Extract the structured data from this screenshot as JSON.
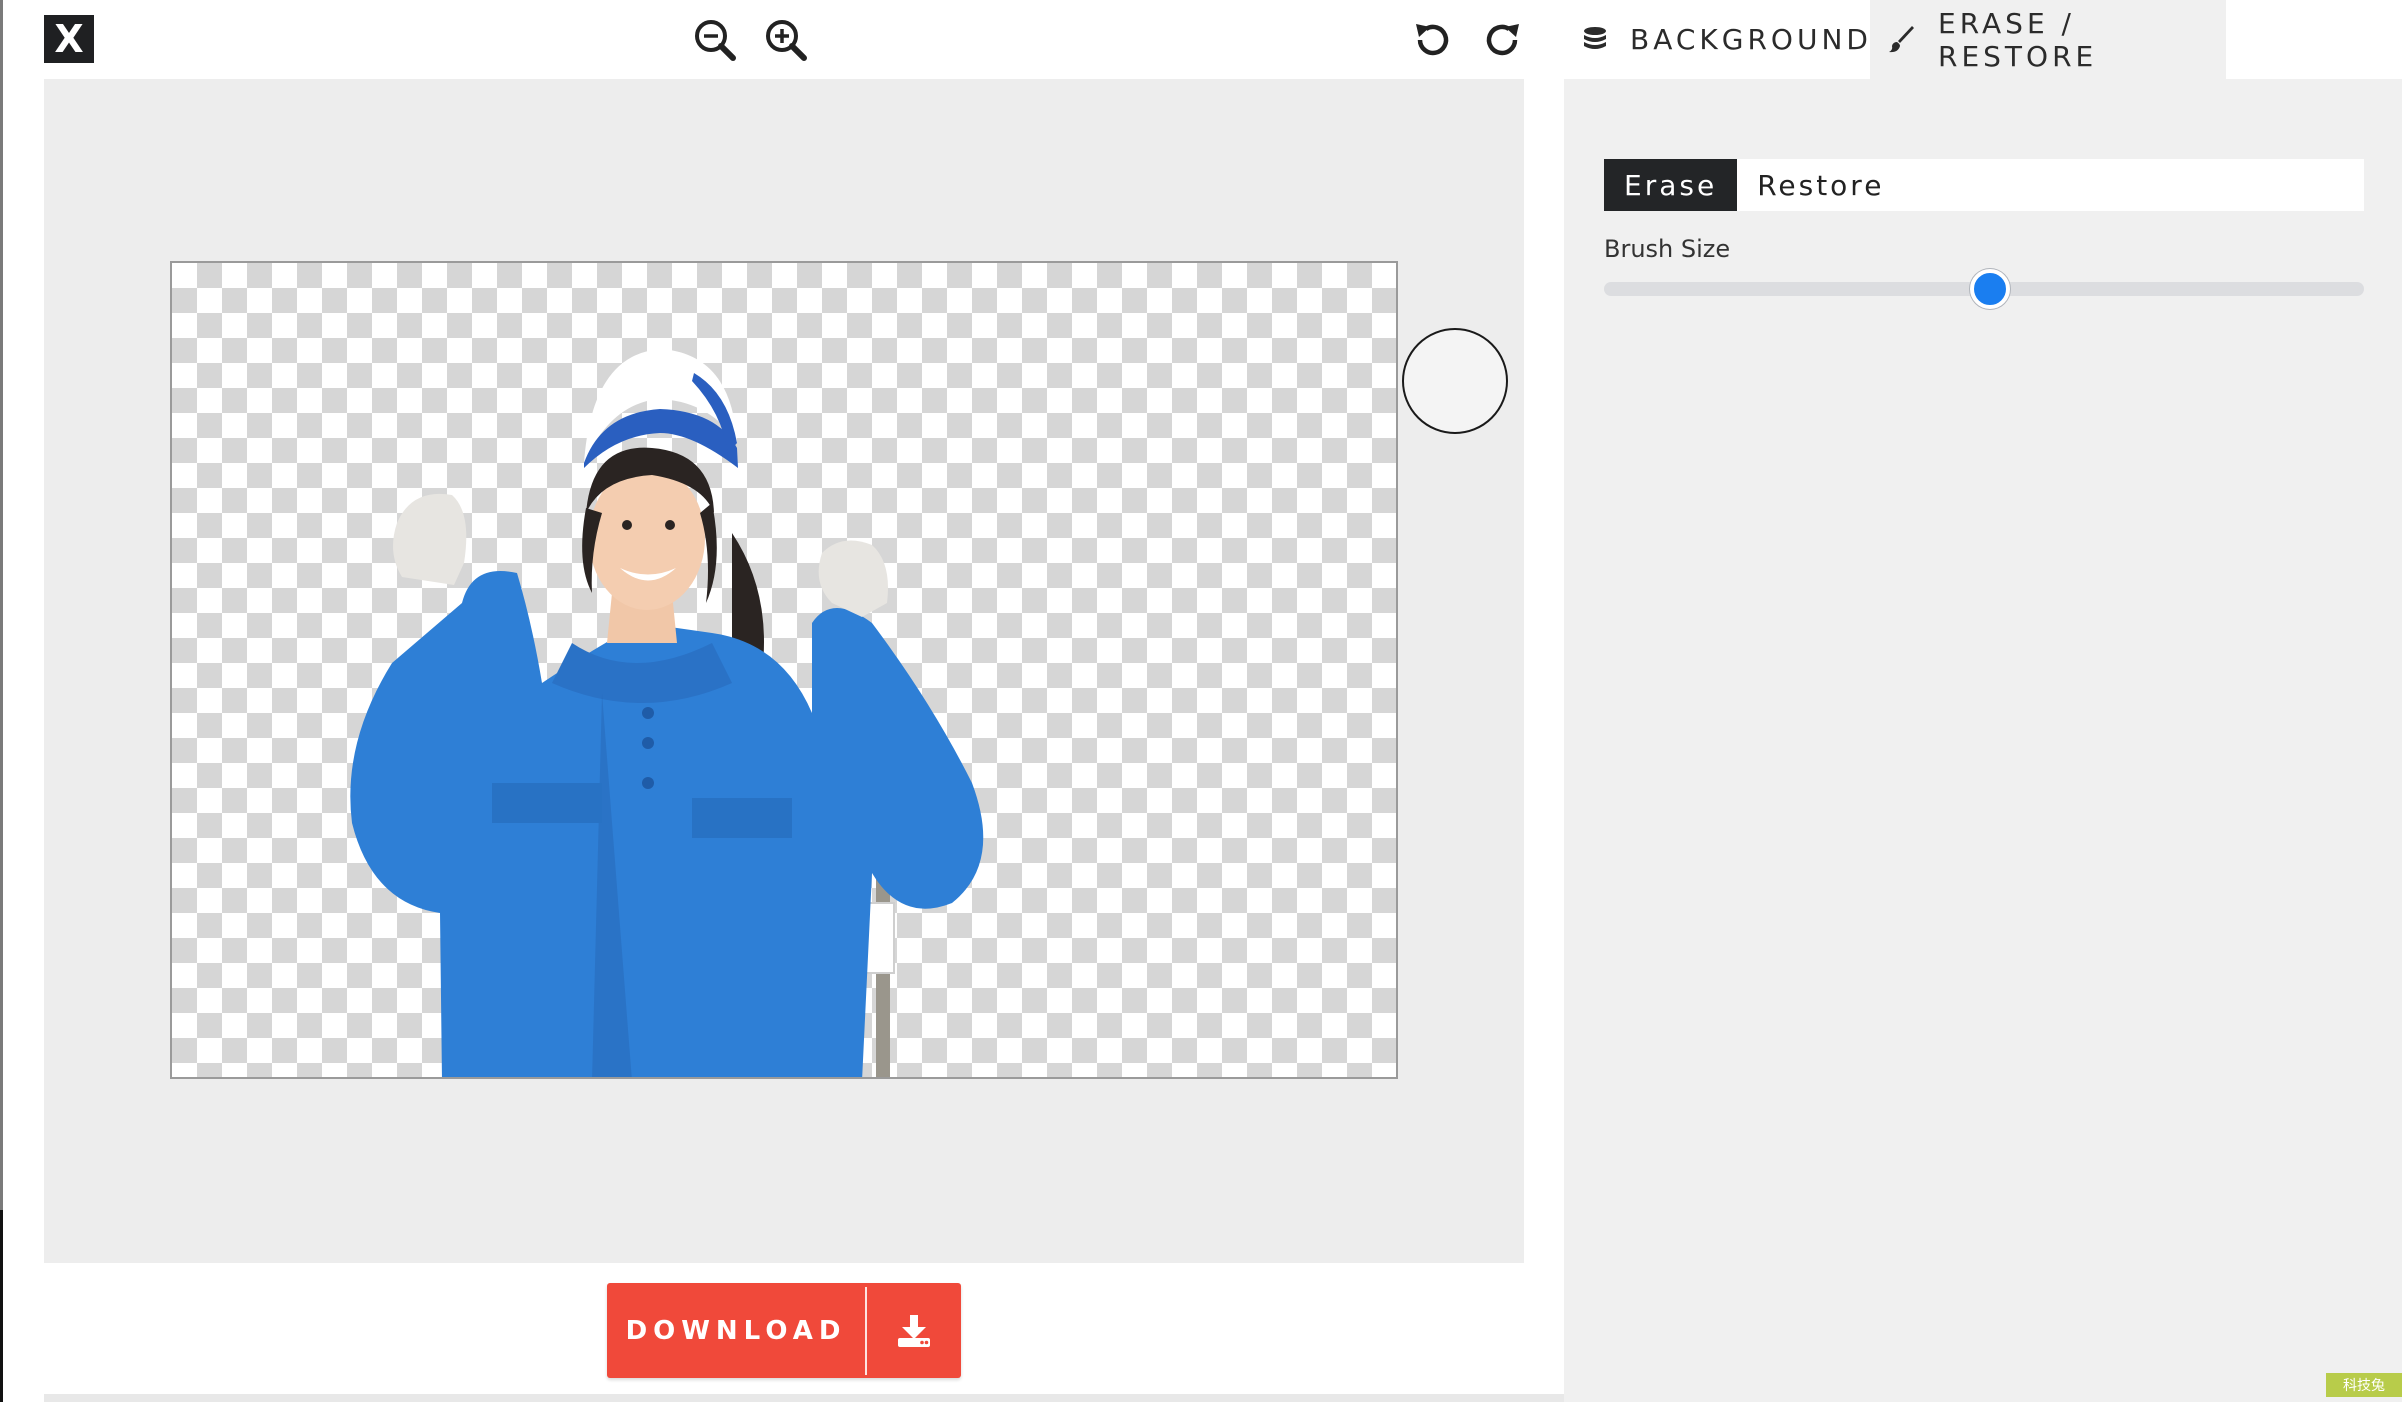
{
  "toolbar": {
    "close_label": "X",
    "icons": [
      "zoom-out-icon",
      "zoom-in-icon",
      "undo-icon",
      "redo-icon"
    ]
  },
  "tabs": [
    {
      "label": "BACKGROUND",
      "icon": "database-icon",
      "active": false
    },
    {
      "label": "ERASE / RESTORE",
      "icon": "brush-icon",
      "active": true
    }
  ],
  "panel": {
    "modes": [
      {
        "label": "Erase",
        "active": true
      },
      {
        "label": "Restore",
        "active": false
      }
    ],
    "brush_size_label": "Brush Size",
    "brush_size_fraction": 0.508
  },
  "download": {
    "label": "DOWNLOAD",
    "icon": "download-icon"
  },
  "watermark": "科技兔",
  "colors": {
    "accent": "#f0493a",
    "slider": "#1a7ef0",
    "active_mode": "#232527",
    "shirt": "#2e7fd6",
    "cap_front": "#2a5fc0"
  }
}
